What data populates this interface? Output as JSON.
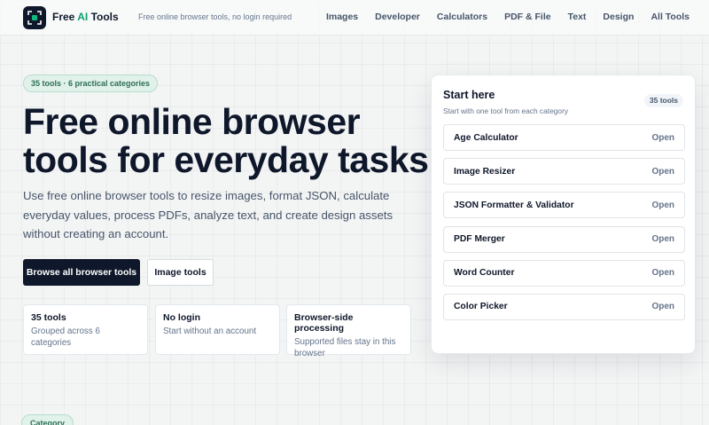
{
  "header": {
    "brand_prefix": "Free ",
    "brand_accent": "AI",
    "brand_suffix": " Tools",
    "tagline": "Free online browser tools, no login required",
    "nav": [
      "Images",
      "Developer",
      "Calculators",
      "PDF & File",
      "Text",
      "Design",
      "All Tools"
    ]
  },
  "hero": {
    "pill": "35 tools · 6 practical categories",
    "title": "Free online browser tools for everyday tasks",
    "description": "Use free online browser tools to resize images, format JSON, calculate everyday values, process PDFs, analyze text, and create design assets without creating an account.",
    "primary_button": "Browse all browser tools",
    "secondary_button": "Image tools",
    "stats": [
      {
        "title": "35 tools",
        "subtitle": "Grouped across 6 categories"
      },
      {
        "title": "No login",
        "subtitle": "Start without an account"
      },
      {
        "title": "Browser-side processing",
        "subtitle": "Supported files stay in this browser"
      }
    ]
  },
  "start_card": {
    "title": "Start here",
    "subtitle": "Start with one tool from each category",
    "badge": "35 tools",
    "tools": [
      {
        "name": "Age Calculator",
        "action": "Open"
      },
      {
        "name": "Image Resizer",
        "action": "Open"
      },
      {
        "name": "JSON Formatter & Validator",
        "action": "Open"
      },
      {
        "name": "PDF Merger",
        "action": "Open"
      },
      {
        "name": "Word Counter",
        "action": "Open"
      },
      {
        "name": "Color Picker",
        "action": "Open"
      }
    ]
  },
  "category_pill": "Category",
  "colors": {
    "accent": "#0e9f6e",
    "dark": "#0f172a",
    "pill_bg": "#e0f2ea",
    "pill_text": "#2f6f57"
  },
  "icons": {
    "logo": "tool-logo-icon"
  }
}
